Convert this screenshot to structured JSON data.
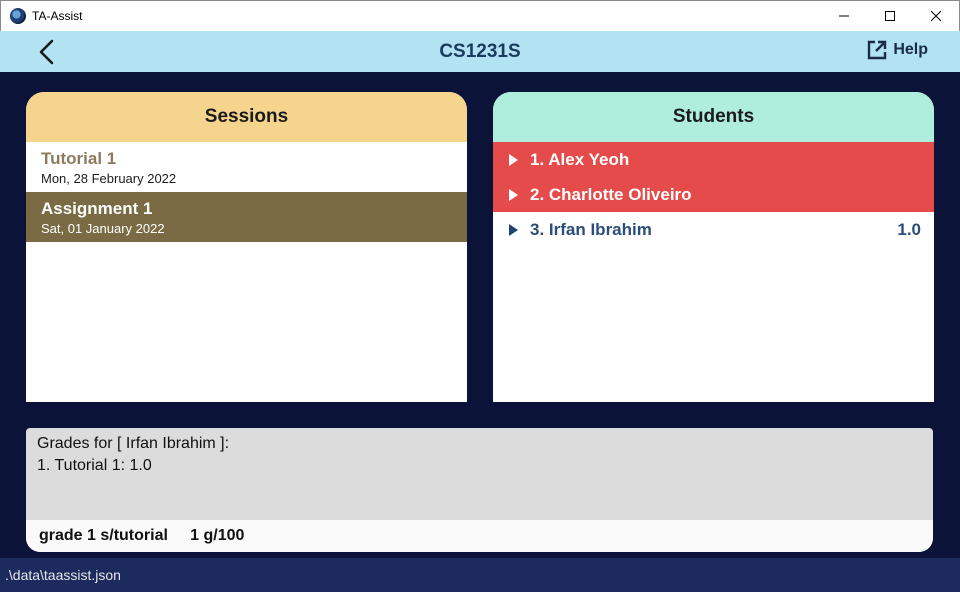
{
  "window": {
    "title": "TA-Assist"
  },
  "header": {
    "title": "CS1231S",
    "help_label": "Help"
  },
  "sessions": {
    "title": "Sessions",
    "items": [
      {
        "name": "Tutorial 1",
        "date": "Mon, 28 February 2022"
      },
      {
        "name": "Assignment 1",
        "date": "Sat, 01 January 2022"
      }
    ]
  },
  "students": {
    "title": "Students",
    "items": [
      {
        "label": "1. Alex Yeoh",
        "grade": ""
      },
      {
        "label": "2. Charlotte Oliveiro",
        "grade": ""
      },
      {
        "label": "3. Irfan Ibrahim",
        "grade": "1.0"
      }
    ]
  },
  "result": {
    "text": "Grades for [ Irfan Ibrahim ]:\n1. Tutorial 1: 1.0"
  },
  "command": {
    "value": "grade 1 s/tutorial     1 g/100"
  },
  "status": {
    "path": ".\\data\\taassist.json"
  },
  "colors": {
    "background": "#0b1339",
    "header": "#b3e2f2",
    "sessions_header": "#f5d48d",
    "students_header": "#afeedc",
    "flagged_student": "#e54b4b",
    "selected_session": "#7a6b45"
  },
  "icons": {
    "back": "chevron-left-icon",
    "help": "external-link-icon",
    "expand": "triangle-right-icon"
  }
}
